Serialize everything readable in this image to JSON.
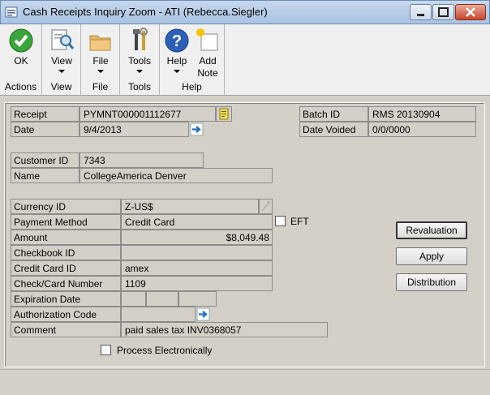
{
  "window": {
    "title": "Cash Receipts Inquiry Zoom  -  ATI (Rebecca.Siegler)"
  },
  "ribbon": {
    "groups": [
      {
        "name": "Actions",
        "buttons": [
          {
            "label": "OK",
            "icon": "ok-check-icon"
          }
        ]
      },
      {
        "name": "View",
        "buttons": [
          {
            "label": "View",
            "icon": "magnifier-document-icon"
          }
        ]
      },
      {
        "name": "File",
        "buttons": [
          {
            "label": "File",
            "icon": "folder-icon"
          }
        ]
      },
      {
        "name": "Tools",
        "buttons": [
          {
            "label": "Tools",
            "icon": "tools-icon"
          }
        ]
      },
      {
        "name": "Help",
        "buttons": [
          {
            "label": "Help",
            "icon": "help-icon"
          },
          {
            "label": "Add\nNote",
            "icon": "add-note-icon"
          }
        ]
      }
    ],
    "add_note_line1": "Add",
    "add_note_line2": "Note"
  },
  "form": {
    "receipt_label": "Receipt",
    "receipt_value": "PYMNT000001112677",
    "date_label": "Date",
    "date_value": "9/4/2013",
    "batch_id_label": "Batch ID",
    "batch_id_value": "RMS 20130904",
    "date_voided_label": "Date Voided",
    "date_voided_value": "0/0/0000",
    "customer_id_label": "Customer ID",
    "customer_id_value": "7343",
    "name_label": "Name",
    "name_value": "CollegeAmerica Denver",
    "currency_id_label": "Currency ID",
    "currency_id_value": "Z-US$",
    "payment_method_label": "Payment Method",
    "payment_method_value": "Credit Card",
    "eft_label": "EFT",
    "amount_label": "Amount",
    "amount_value": "$8,049.48",
    "checkbook_id_label": "Checkbook ID",
    "checkbook_id_value": "",
    "credit_card_id_label": "Credit Card ID",
    "credit_card_id_value": "amex",
    "check_card_number_label": "Check/Card Number",
    "check_card_number_value": "1109",
    "expiration_date_label": "Expiration Date",
    "authorization_code_label": "Authorization Code",
    "authorization_code_value": "",
    "comment_label": "Comment",
    "comment_value": "paid sales tax INV0368057",
    "process_electronically_label": "Process Electronically"
  },
  "buttons": {
    "revaluation": "Revaluation",
    "apply": "Apply",
    "distribution": "Distribution"
  },
  "colors": {
    "window_bg": "#d4d0c8",
    "ribbon_bg": "#f0f0f0",
    "titlebar": "#b8cde8",
    "ok_green": "#3aa53a",
    "help_blue": "#2b5fb8"
  }
}
